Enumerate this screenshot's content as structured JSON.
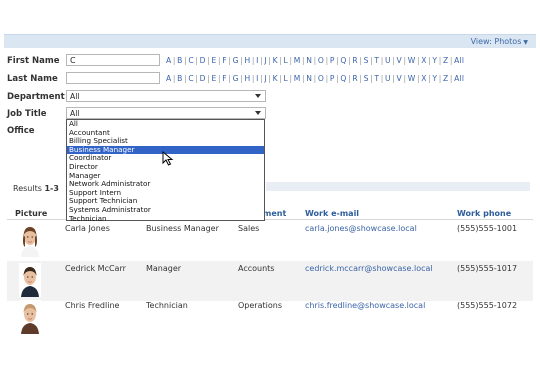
{
  "toolbar": {
    "view_label": "View:",
    "view_value": "Photos"
  },
  "filters": {
    "first_name": {
      "label": "First Name",
      "value": "C"
    },
    "last_name": {
      "label": "Last Name",
      "value": ""
    },
    "department": {
      "label": "Department",
      "value": "All"
    },
    "job_title": {
      "label": "Job Title",
      "value": "All"
    },
    "office": {
      "label": "Office"
    }
  },
  "alphabet": [
    "A",
    "B",
    "C",
    "D",
    "E",
    "F",
    "G",
    "H",
    "I",
    "J",
    "K",
    "L",
    "M",
    "N",
    "O",
    "P",
    "Q",
    "R",
    "S",
    "T",
    "U",
    "V",
    "W",
    "X",
    "Y",
    "Z",
    "All"
  ],
  "job_title_options": [
    "All",
    "Accountant",
    "Billing Specialist",
    "Business Manager",
    "Coordinator",
    "Director",
    "Manager",
    "Network Administrator",
    "Support Intern",
    "Support Technician",
    "Systems Administrator",
    "Technician"
  ],
  "highlighted_option_index": 3,
  "results": {
    "prefix": "Results",
    "range": "1-3"
  },
  "columns": {
    "picture": "Picture",
    "department": "ment",
    "email": "Work e-mail",
    "phone": "Work phone"
  },
  "people": [
    {
      "name": "Carla Jones",
      "title": "Business Manager",
      "department": "Sales",
      "email": "carla.jones@showcase.local",
      "phone": "(555)555-1001"
    },
    {
      "name": "Cedrick McCarr",
      "title": "Manager",
      "department": "Accounts",
      "email": "cedrick.mccarr@showcase.local",
      "phone": "(555)555-1017"
    },
    {
      "name": "Chris Fredline",
      "title": "Technician",
      "department": "Operations",
      "email": "chris.fredline@showcase.local",
      "phone": "(555)555-1072"
    }
  ],
  "colors": {
    "link": "#3a64a8",
    "highlight": "#3264c8",
    "topbar": "#dbe6f3",
    "header_text": "#2d5d9a"
  }
}
